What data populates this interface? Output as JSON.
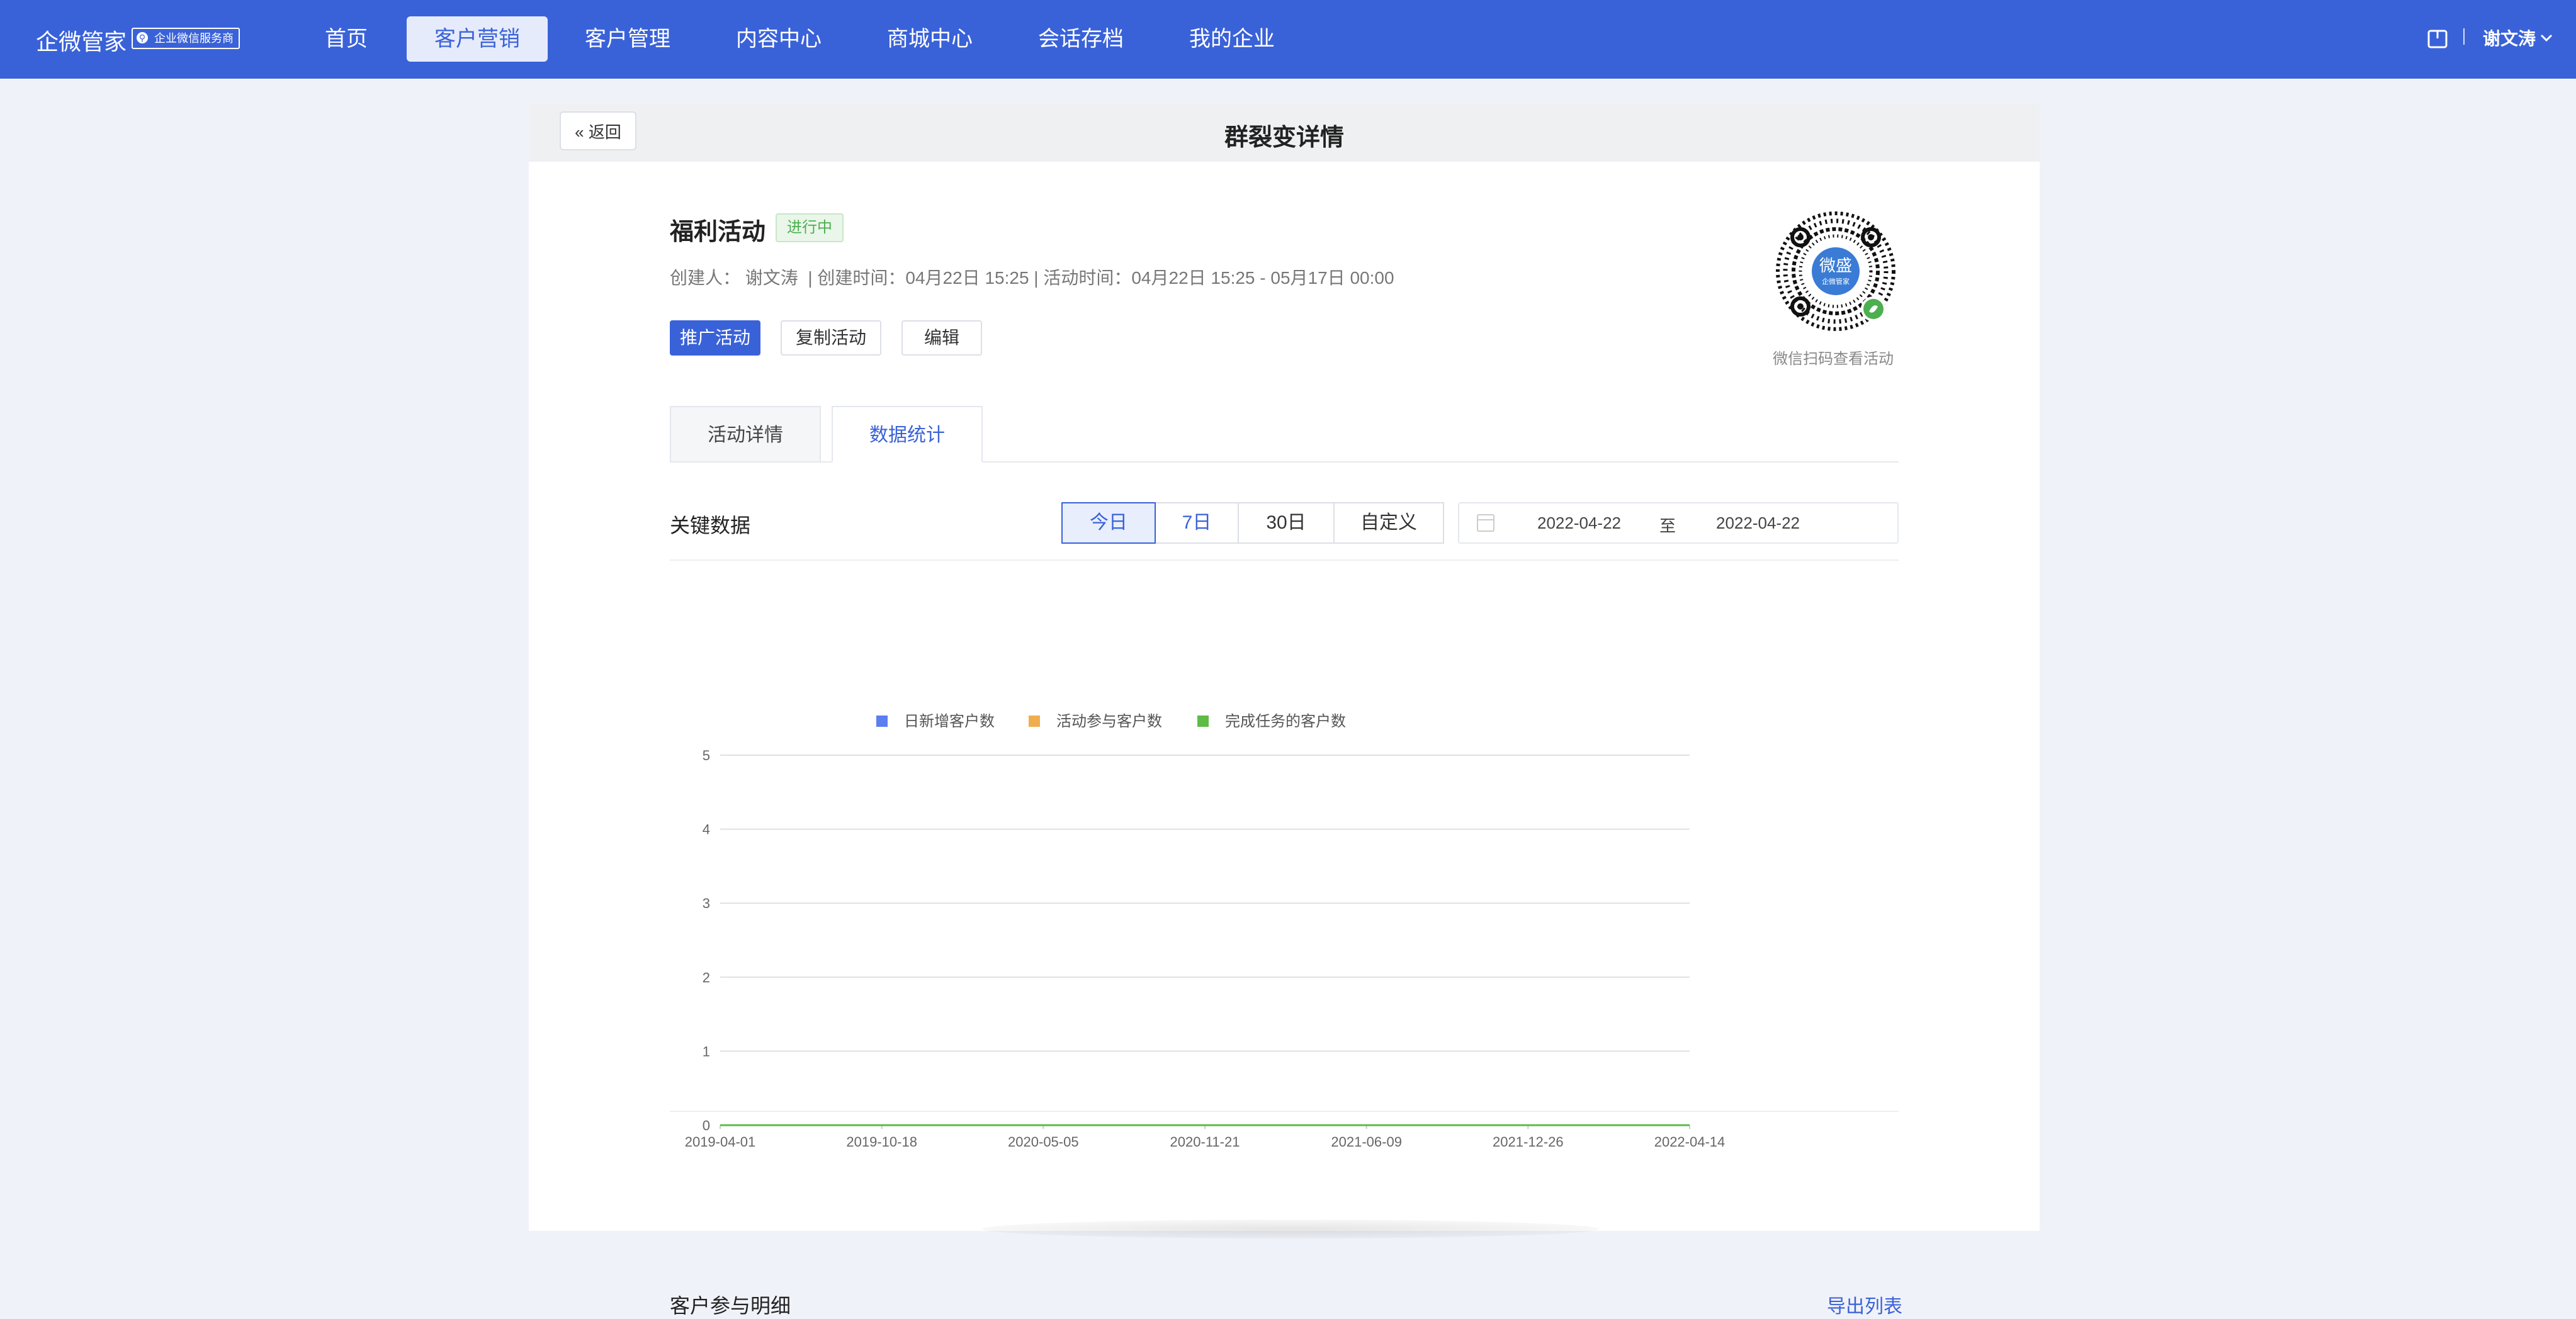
{
  "nav": {
    "brand": "企微管家",
    "badge": "企业微信服务商",
    "items": [
      {
        "label": "首页",
        "active": false
      },
      {
        "label": "客户营销",
        "active": true
      },
      {
        "label": "客户管理",
        "active": false
      },
      {
        "label": "内容中心",
        "active": false
      },
      {
        "label": "商城中心",
        "active": false
      },
      {
        "label": "会话存档",
        "active": false
      },
      {
        "label": "我的企业",
        "active": false
      }
    ],
    "user": "谢文涛"
  },
  "page": {
    "back_label": "返回",
    "title": "群裂变详情"
  },
  "activity": {
    "name": "福利活动",
    "status": "进行中",
    "meta": "创建人： 谢文涛  | 创建时间：04月22日 15:25 | 活动时间：04月22日 15:25 - 05月17日 00:00",
    "buttons": [
      "推广活动",
      "复制活动",
      "编辑"
    ],
    "qr_caption": "微信扫码查看活动",
    "qr_center": "微盛",
    "qr_center_sub": "企微管家"
  },
  "tabs": [
    {
      "label": "活动详情",
      "active": false
    },
    {
      "label": "数据统计",
      "active": true
    }
  ],
  "key_data": {
    "title": "关键数据",
    "ranges": [
      "今日",
      "7日",
      "30日",
      "自定义"
    ],
    "selected_range": "今日",
    "date_from": "2022-04-22",
    "date_sep": "至",
    "date_to": "2022-04-22"
  },
  "chart_data": {
    "type": "line",
    "x": [
      "2019-04-01",
      "2019-10-18",
      "2020-05-05",
      "2020-11-21",
      "2021-06-09",
      "2021-12-26",
      "2022-04-14"
    ],
    "series": [
      {
        "name": "日新增客户数",
        "color": "#5b7ef0",
        "values": [
          0,
          0,
          0,
          0,
          0,
          0,
          0
        ]
      },
      {
        "name": "活动参与客户数",
        "color": "#f0ad4e",
        "values": [
          0,
          0,
          0,
          0,
          0,
          0,
          0
        ]
      },
      {
        "name": "完成任务的客户数",
        "color": "#5dbb46",
        "values": [
          0,
          0,
          0,
          0,
          0,
          0,
          0
        ]
      }
    ],
    "yticks": [
      0,
      1,
      2,
      3,
      4,
      5
    ],
    "ylim": [
      0,
      5
    ],
    "grid": true,
    "legend": "top-center"
  },
  "detail": {
    "title": "客户参与明细",
    "export_label": "导出列表"
  }
}
